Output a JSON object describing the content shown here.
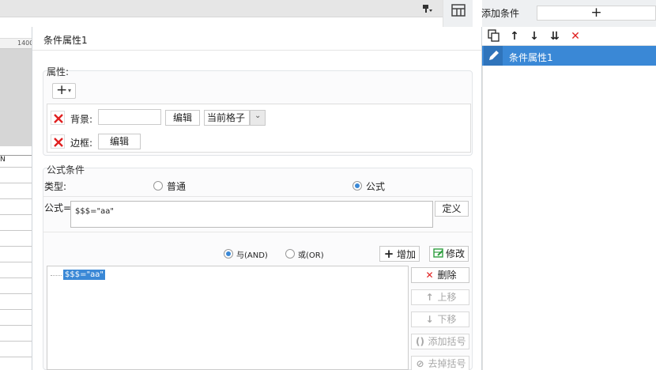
{
  "left_sheet": {
    "ruler_label": "1400",
    "column_header": "N"
  },
  "dialog": {
    "title": "条件属性1",
    "property_section": {
      "legend": "属性:",
      "add_button_label": "+",
      "background_label": "背景:",
      "background_value": "",
      "edit_label": "编辑",
      "scope_select_value": "当前格子",
      "border_label": "边框:",
      "border_edit_label": "编辑"
    },
    "formula_section": {
      "legend": "公式条件",
      "type_label": "类型:",
      "type_options": [
        {
          "label": "普通",
          "selected": false
        },
        {
          "label": "公式",
          "selected": true
        }
      ],
      "formula_label": "公式=",
      "formula_value": "$$$=\"aa\"",
      "define_button": "定义",
      "logic_options": [
        {
          "label": "与(AND)",
          "selected": true
        },
        {
          "label": "或(OR)",
          "selected": false
        }
      ],
      "add_button": "增加",
      "modify_button": "修改",
      "condition_list": [
        "$$$=\"aa\""
      ],
      "delete_button": "删除",
      "move_up_button": "上移",
      "move_down_button": "下移",
      "add_bracket_button": "添加括号",
      "remove_bracket_button": "去掉括号"
    }
  },
  "right_panel": {
    "title": "添加条件",
    "add_button_label": "+",
    "items": [
      "条件属性1"
    ]
  },
  "colors": {
    "accent": "#3a88d6",
    "delete_red": "#e02020",
    "modify_green": "#2e9e3e"
  }
}
